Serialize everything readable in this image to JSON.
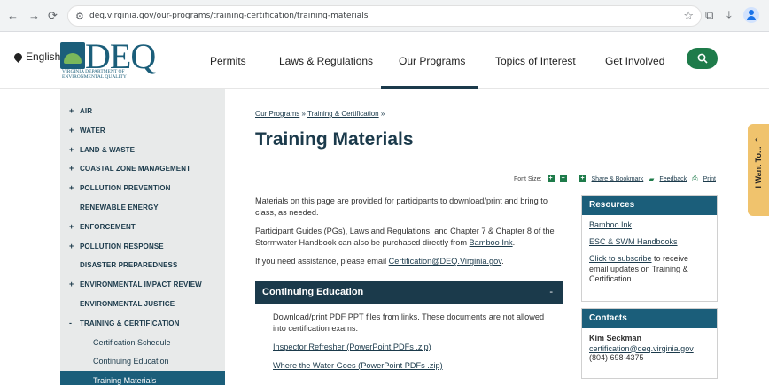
{
  "browser": {
    "url": "deq.virginia.gov/our-programs/training-certification/training-materials"
  },
  "header": {
    "language": "English",
    "logo_text": "DEQ",
    "logo_subtext": "VIRGINIA DEPARTMENT OF ENVIRONMENTAL QUALITY",
    "nav": [
      "Permits",
      "Laws & Regulations",
      "Our Programs",
      "Topics of Interest",
      "Get Involved"
    ],
    "active_nav": "Our Programs"
  },
  "sidebar": {
    "items": [
      {
        "pm": "+",
        "label": "AIR"
      },
      {
        "pm": "+",
        "label": "WATER"
      },
      {
        "pm": "+",
        "label": "LAND & WASTE"
      },
      {
        "pm": "+",
        "label": "COASTAL ZONE MANAGEMENT"
      },
      {
        "pm": "+",
        "label": "POLLUTION PREVENTION"
      },
      {
        "pm": "",
        "label": "RENEWABLE ENERGY"
      },
      {
        "pm": "+",
        "label": "ENFORCEMENT"
      },
      {
        "pm": "+",
        "label": "POLLUTION RESPONSE"
      },
      {
        "pm": "",
        "label": "DISASTER PREPAREDNESS"
      },
      {
        "pm": "+",
        "label": "ENVIRONMENTAL IMPACT REVIEW"
      },
      {
        "pm": "",
        "label": "ENVIRONMENTAL JUSTICE"
      },
      {
        "pm": "-",
        "label": "TRAINING & CERTIFICATION"
      }
    ],
    "subitems": [
      "Certification Schedule",
      "Continuing Education",
      "Training Materials"
    ]
  },
  "main": {
    "breadcrumb": [
      "Our Programs",
      "Training & Certification"
    ],
    "breadcrumb_sep": "»",
    "title": "Training Materials",
    "tools": {
      "font_size_label": "Font Size:",
      "plus": "+",
      "minus": "−",
      "share": "Share & Bookmark",
      "feedback": "Feedback",
      "print": "Print"
    },
    "p1": "Materials on this page are provided for participants to download/print and bring to class, as needed.",
    "p2_pre": "Participant Guides (PGs), Laws and Regulations, and Chapter 7 & Chapter 8 of the Stormwater Handbook can also be purchased directly from ",
    "p2_link": "Bamboo Ink",
    "p2_post": ".",
    "p3_pre": "If you need assistance, please email ",
    "p3_link": "Certification@DEQ.Virginia.gov",
    "p3_post": ".",
    "section_title": "Continuing Education",
    "section_toggle": "-",
    "section_text": "Download/print PDF PPT files from links. These documents are not allowed into certification exams.",
    "section_links": [
      "Inspector Refresher (PowerPoint PDFs .zip)",
      "Where the Water Goes (PowerPoint PDFs .zip)"
    ]
  },
  "resources": {
    "title": "Resources",
    "links": [
      "Bamboo Ink",
      "ESC & SWM Handbooks"
    ],
    "subscribe_link": "Click to subscribe",
    "subscribe_text": " to receive email updates on Training & Certification"
  },
  "contacts": {
    "title": "Contacts",
    "name": "Kim Seckman",
    "email": "certification@deq.virginia.gov",
    "phone": "(804) 698-4375"
  },
  "iwant": {
    "label": "I Want To..."
  }
}
